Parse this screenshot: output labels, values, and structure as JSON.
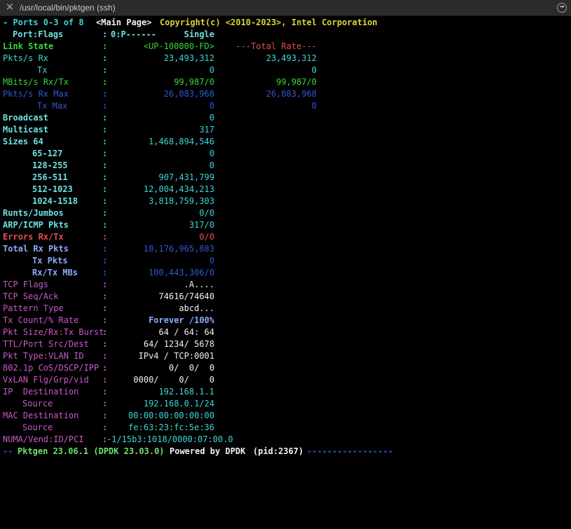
{
  "window": {
    "title": "/usr/local/bin/pktgen (ssh)",
    "close_icon": "close-icon",
    "more_icon": "more-options-icon"
  },
  "header": {
    "ports": "- Ports 0-3 of 8",
    "page": "<Main Page>",
    "copyright": "Copyright(c) <2010-2023>, Intel Corporation"
  },
  "port_flags": {
    "label": "Port:Flags",
    "colon": ":",
    "value": "0:P------",
    "mode": "Single"
  },
  "rows": [
    {
      "label": "Link State",
      "v1": "<UP-100000-FD>",
      "v2": "---Total Rate---"
    },
    {
      "label": "Pkts/s Rx",
      "v1": "23,493,312",
      "v2": "23,493,312"
    },
    {
      "label": "Tx",
      "v1": "0",
      "v2": "0"
    },
    {
      "label": "MBits/s Rx/Tx",
      "v1": "99,987/0",
      "v2": "99,987/0"
    },
    {
      "label": "Pkts/s Rx Max",
      "v1": "26,083,968",
      "v2": "26,083,968"
    },
    {
      "label": "Tx Max",
      "v1": "0",
      "v2": "0"
    },
    {
      "label": "Broadcast",
      "v1": "0"
    },
    {
      "label": "Multicast",
      "v1": "317"
    },
    {
      "label": "Sizes 64",
      "v1": "1,468,894,546"
    },
    {
      "label": "65-127",
      "v1": "0"
    },
    {
      "label": "128-255",
      "v1": "0"
    },
    {
      "label": "256-511",
      "v1": "907,431,799"
    },
    {
      "label": "512-1023",
      "v1": "12,004,434,213"
    },
    {
      "label": "1024-1518",
      "v1": "3,818,759,303"
    },
    {
      "label": "Runts/Jumbos",
      "v1": "0/0"
    },
    {
      "label": "ARP/ICMP Pkts",
      "v1": "317/0"
    },
    {
      "label": "Errors Rx/Tx",
      "v1": "0/0"
    },
    {
      "label": "Total Rx Pkts",
      "v1": "18,176,965,883"
    },
    {
      "label": "Tx Pkts",
      "v1": "0"
    },
    {
      "label": "Rx/Tx MBs",
      "v1": "100,443,306/0"
    },
    {
      "label": "TCP Flags",
      "v1": ".A...."
    },
    {
      "label": "TCP Seq/Ack",
      "v1": "74616/74640"
    },
    {
      "label": "Pattern Type",
      "v1": "abcd..."
    },
    {
      "label": "Tx Count/% Rate",
      "v1": "Forever /100%"
    },
    {
      "label": "Pkt Size/Rx:Tx Burst",
      "v1": "64 / 64: 64"
    },
    {
      "label": "TTL/Port Src/Dest",
      "v1": "64/ 1234/ 5678"
    },
    {
      "label": "Pkt Type:VLAN ID",
      "v1": "IPv4 / TCP:0001"
    },
    {
      "label": "802.1p CoS/DSCP/IPP",
      "v1": "0/  0/  0"
    },
    {
      "label": "VxLAN Flg/Grp/vid",
      "v1": "0000/    0/    0"
    },
    {
      "label": "IP  Destination",
      "v1": "192.168.1.1"
    },
    {
      "label": "Source",
      "v1": "192.168.0.1/24"
    },
    {
      "label": "MAC Destination",
      "v1": "00:00:00:00:00:00"
    },
    {
      "label": "Source",
      "v1": "fe:63:23:fc:5e:36"
    },
    {
      "label": "NUMA/Vend:ID/PCI",
      "v1": "-1/15b3:1018/0000:07:00.0"
    }
  ],
  "colon": ":",
  "footer": {
    "prefix": "--",
    "version": "Pktgen 23.06.1 (DPDK 23.03.0)",
    "powered": "Powered by DPDK",
    "pid": "(pid:2367)",
    "dashes": "-----------------"
  },
  "colors": {
    "background": "#000000",
    "cyan": "#3fd4d4",
    "green": "#38d638",
    "blue": "#2f56d6",
    "yellow": "#d8d23a",
    "red": "#e05050",
    "magenta": "#c85ac8"
  }
}
